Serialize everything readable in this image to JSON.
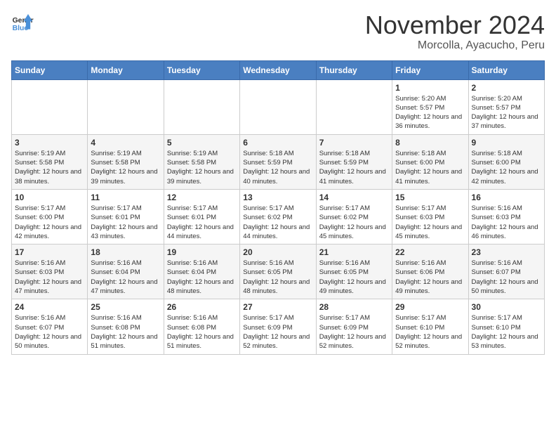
{
  "header": {
    "logo_line1": "General",
    "logo_line2": "Blue",
    "title": "November 2024",
    "subtitle": "Morcolla, Ayacucho, Peru"
  },
  "days_of_week": [
    "Sunday",
    "Monday",
    "Tuesday",
    "Wednesday",
    "Thursday",
    "Friday",
    "Saturday"
  ],
  "weeks": [
    [
      null,
      null,
      null,
      null,
      null,
      {
        "date": "1",
        "sunrise": "5:20 AM",
        "sunset": "5:57 PM",
        "daylight": "12 hours and 36 minutes."
      },
      {
        "date": "2",
        "sunrise": "5:20 AM",
        "sunset": "5:57 PM",
        "daylight": "12 hours and 37 minutes."
      }
    ],
    [
      {
        "date": "3",
        "sunrise": "5:19 AM",
        "sunset": "5:58 PM",
        "daylight": "12 hours and 38 minutes."
      },
      {
        "date": "4",
        "sunrise": "5:19 AM",
        "sunset": "5:58 PM",
        "daylight": "12 hours and 39 minutes."
      },
      {
        "date": "5",
        "sunrise": "5:19 AM",
        "sunset": "5:58 PM",
        "daylight": "12 hours and 39 minutes."
      },
      {
        "date": "6",
        "sunrise": "5:18 AM",
        "sunset": "5:59 PM",
        "daylight": "12 hours and 40 minutes."
      },
      {
        "date": "7",
        "sunrise": "5:18 AM",
        "sunset": "5:59 PM",
        "daylight": "12 hours and 41 minutes."
      },
      {
        "date": "8",
        "sunrise": "5:18 AM",
        "sunset": "6:00 PM",
        "daylight": "12 hours and 41 minutes."
      },
      {
        "date": "9",
        "sunrise": "5:18 AM",
        "sunset": "6:00 PM",
        "daylight": "12 hours and 42 minutes."
      }
    ],
    [
      {
        "date": "10",
        "sunrise": "5:17 AM",
        "sunset": "6:00 PM",
        "daylight": "12 hours and 42 minutes."
      },
      {
        "date": "11",
        "sunrise": "5:17 AM",
        "sunset": "6:01 PM",
        "daylight": "12 hours and 43 minutes."
      },
      {
        "date": "12",
        "sunrise": "5:17 AM",
        "sunset": "6:01 PM",
        "daylight": "12 hours and 44 minutes."
      },
      {
        "date": "13",
        "sunrise": "5:17 AM",
        "sunset": "6:02 PM",
        "daylight": "12 hours and 44 minutes."
      },
      {
        "date": "14",
        "sunrise": "5:17 AM",
        "sunset": "6:02 PM",
        "daylight": "12 hours and 45 minutes."
      },
      {
        "date": "15",
        "sunrise": "5:17 AM",
        "sunset": "6:03 PM",
        "daylight": "12 hours and 45 minutes."
      },
      {
        "date": "16",
        "sunrise": "5:16 AM",
        "sunset": "6:03 PM",
        "daylight": "12 hours and 46 minutes."
      }
    ],
    [
      {
        "date": "17",
        "sunrise": "5:16 AM",
        "sunset": "6:03 PM",
        "daylight": "12 hours and 47 minutes."
      },
      {
        "date": "18",
        "sunrise": "5:16 AM",
        "sunset": "6:04 PM",
        "daylight": "12 hours and 47 minutes."
      },
      {
        "date": "19",
        "sunrise": "5:16 AM",
        "sunset": "6:04 PM",
        "daylight": "12 hours and 48 minutes."
      },
      {
        "date": "20",
        "sunrise": "5:16 AM",
        "sunset": "6:05 PM",
        "daylight": "12 hours and 48 minutes."
      },
      {
        "date": "21",
        "sunrise": "5:16 AM",
        "sunset": "6:05 PM",
        "daylight": "12 hours and 49 minutes."
      },
      {
        "date": "22",
        "sunrise": "5:16 AM",
        "sunset": "6:06 PM",
        "daylight": "12 hours and 49 minutes."
      },
      {
        "date": "23",
        "sunrise": "5:16 AM",
        "sunset": "6:07 PM",
        "daylight": "12 hours and 50 minutes."
      }
    ],
    [
      {
        "date": "24",
        "sunrise": "5:16 AM",
        "sunset": "6:07 PM",
        "daylight": "12 hours and 50 minutes."
      },
      {
        "date": "25",
        "sunrise": "5:16 AM",
        "sunset": "6:08 PM",
        "daylight": "12 hours and 51 minutes."
      },
      {
        "date": "26",
        "sunrise": "5:16 AM",
        "sunset": "6:08 PM",
        "daylight": "12 hours and 51 minutes."
      },
      {
        "date": "27",
        "sunrise": "5:17 AM",
        "sunset": "6:09 PM",
        "daylight": "12 hours and 52 minutes."
      },
      {
        "date": "28",
        "sunrise": "5:17 AM",
        "sunset": "6:09 PM",
        "daylight": "12 hours and 52 minutes."
      },
      {
        "date": "29",
        "sunrise": "5:17 AM",
        "sunset": "6:10 PM",
        "daylight": "12 hours and 52 minutes."
      },
      {
        "date": "30",
        "sunrise": "5:17 AM",
        "sunset": "6:10 PM",
        "daylight": "12 hours and 53 minutes."
      }
    ]
  ]
}
